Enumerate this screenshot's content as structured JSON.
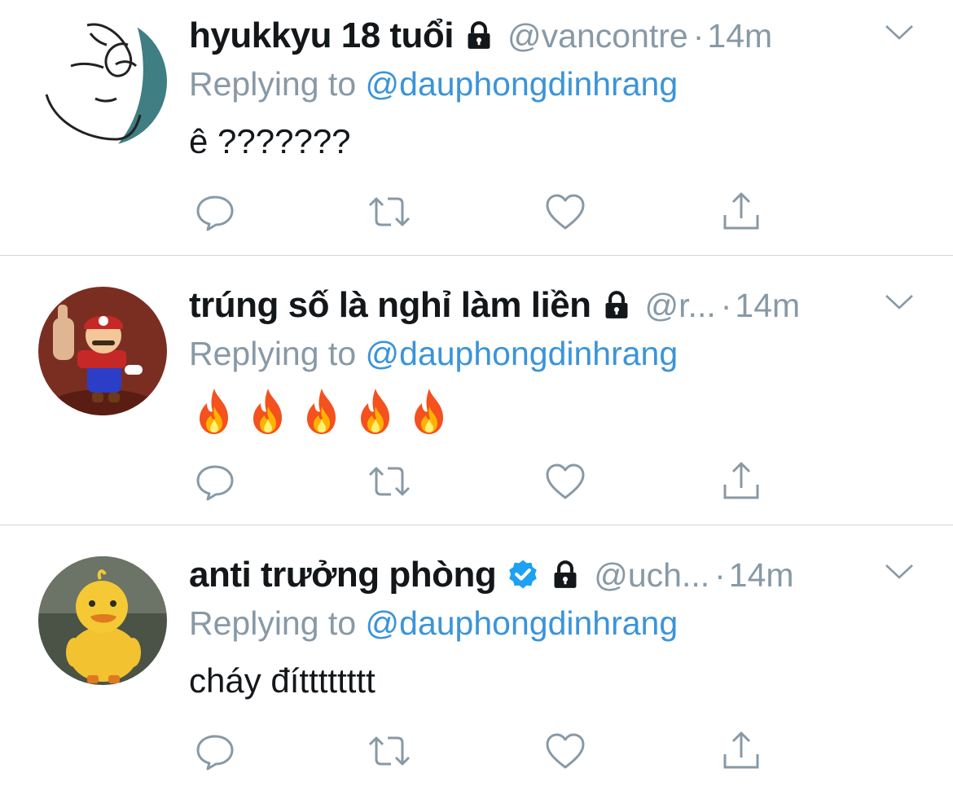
{
  "colors": {
    "name": "#14171a",
    "muted": "#8899a6",
    "link": "#3b94d9",
    "divider": "#d3d6d9",
    "verified": "#1da1f2"
  },
  "tweets": [
    {
      "name": "hyukkyu 18 tuổi",
      "locked": true,
      "verified": false,
      "handle": "@vancontre",
      "dot": "·",
      "time": "14m",
      "reply_prefix": "Replying to",
      "reply_to": "@dauphongdinhrang",
      "text": "ê ???????",
      "avatar_icon": "meme-face-avatar"
    },
    {
      "name": "trúng số là nghỉ làm liền",
      "locked": true,
      "verified": false,
      "handle": "@r...",
      "dot": "·",
      "time": "14m",
      "reply_prefix": "Replying to",
      "reply_to": "@dauphongdinhrang",
      "text_emoji": [
        "fire-icon",
        "fire-icon",
        "fire-icon",
        "fire-icon",
        "fire-icon"
      ],
      "avatar_icon": "mario-avatar"
    },
    {
      "name": "anti trưởng phòng",
      "locked": true,
      "verified": true,
      "handle": "@uch...",
      "dot": "·",
      "time": "14m",
      "reply_prefix": "Replying to",
      "reply_to": "@dauphongdinhrang",
      "text": "cháy đítttttttt",
      "avatar_icon": "duck-avatar"
    }
  ],
  "action_icons": [
    "reply-icon",
    "retweet-icon",
    "like-icon",
    "share-icon"
  ]
}
